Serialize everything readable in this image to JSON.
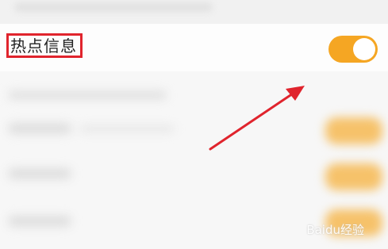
{
  "setting": {
    "label": "热点信息",
    "toggle_on": true,
    "toggle_color": "#f5a623"
  },
  "watermark": "Baidu经验",
  "colors": {
    "highlight_border": "#e0242d",
    "arrow": "#e0242d"
  }
}
